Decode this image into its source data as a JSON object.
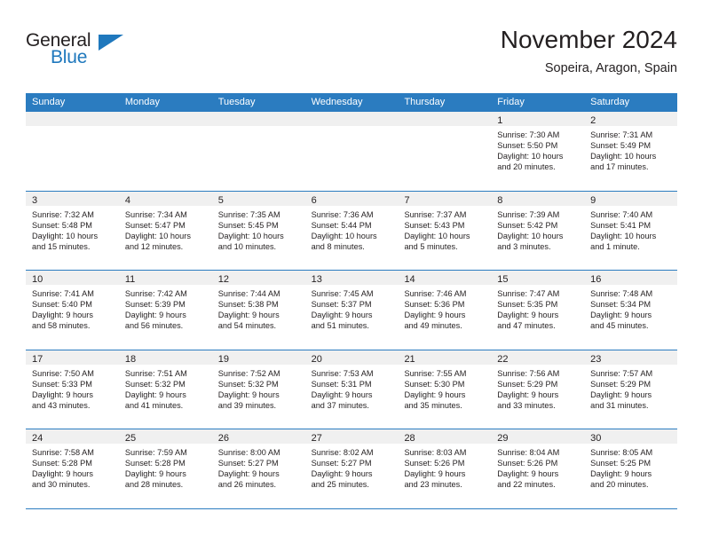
{
  "brand": {
    "name_part1": "General",
    "name_part2": "Blue",
    "accent_color": "#1f78bd"
  },
  "header": {
    "month_title": "November 2024",
    "location": "Sopeira, Aragon, Spain"
  },
  "calendar": {
    "header_color": "#2b7cc0",
    "weekdays": [
      "Sunday",
      "Monday",
      "Tuesday",
      "Wednesday",
      "Thursday",
      "Friday",
      "Saturday"
    ],
    "weeks": [
      [
        {
          "day": "",
          "lines": []
        },
        {
          "day": "",
          "lines": []
        },
        {
          "day": "",
          "lines": []
        },
        {
          "day": "",
          "lines": []
        },
        {
          "day": "",
          "lines": []
        },
        {
          "day": "1",
          "lines": [
            "Sunrise: 7:30 AM",
            "Sunset: 5:50 PM",
            "Daylight: 10 hours",
            "and 20 minutes."
          ]
        },
        {
          "day": "2",
          "lines": [
            "Sunrise: 7:31 AM",
            "Sunset: 5:49 PM",
            "Daylight: 10 hours",
            "and 17 minutes."
          ]
        }
      ],
      [
        {
          "day": "3",
          "lines": [
            "Sunrise: 7:32 AM",
            "Sunset: 5:48 PM",
            "Daylight: 10 hours",
            "and 15 minutes."
          ]
        },
        {
          "day": "4",
          "lines": [
            "Sunrise: 7:34 AM",
            "Sunset: 5:47 PM",
            "Daylight: 10 hours",
            "and 12 minutes."
          ]
        },
        {
          "day": "5",
          "lines": [
            "Sunrise: 7:35 AM",
            "Sunset: 5:45 PM",
            "Daylight: 10 hours",
            "and 10 minutes."
          ]
        },
        {
          "day": "6",
          "lines": [
            "Sunrise: 7:36 AM",
            "Sunset: 5:44 PM",
            "Daylight: 10 hours",
            "and 8 minutes."
          ]
        },
        {
          "day": "7",
          "lines": [
            "Sunrise: 7:37 AM",
            "Sunset: 5:43 PM",
            "Daylight: 10 hours",
            "and 5 minutes."
          ]
        },
        {
          "day": "8",
          "lines": [
            "Sunrise: 7:39 AM",
            "Sunset: 5:42 PM",
            "Daylight: 10 hours",
            "and 3 minutes."
          ]
        },
        {
          "day": "9",
          "lines": [
            "Sunrise: 7:40 AM",
            "Sunset: 5:41 PM",
            "Daylight: 10 hours",
            "and 1 minute."
          ]
        }
      ],
      [
        {
          "day": "10",
          "lines": [
            "Sunrise: 7:41 AM",
            "Sunset: 5:40 PM",
            "Daylight: 9 hours",
            "and 58 minutes."
          ]
        },
        {
          "day": "11",
          "lines": [
            "Sunrise: 7:42 AM",
            "Sunset: 5:39 PM",
            "Daylight: 9 hours",
            "and 56 minutes."
          ]
        },
        {
          "day": "12",
          "lines": [
            "Sunrise: 7:44 AM",
            "Sunset: 5:38 PM",
            "Daylight: 9 hours",
            "and 54 minutes."
          ]
        },
        {
          "day": "13",
          "lines": [
            "Sunrise: 7:45 AM",
            "Sunset: 5:37 PM",
            "Daylight: 9 hours",
            "and 51 minutes."
          ]
        },
        {
          "day": "14",
          "lines": [
            "Sunrise: 7:46 AM",
            "Sunset: 5:36 PM",
            "Daylight: 9 hours",
            "and 49 minutes."
          ]
        },
        {
          "day": "15",
          "lines": [
            "Sunrise: 7:47 AM",
            "Sunset: 5:35 PM",
            "Daylight: 9 hours",
            "and 47 minutes."
          ]
        },
        {
          "day": "16",
          "lines": [
            "Sunrise: 7:48 AM",
            "Sunset: 5:34 PM",
            "Daylight: 9 hours",
            "and 45 minutes."
          ]
        }
      ],
      [
        {
          "day": "17",
          "lines": [
            "Sunrise: 7:50 AM",
            "Sunset: 5:33 PM",
            "Daylight: 9 hours",
            "and 43 minutes."
          ]
        },
        {
          "day": "18",
          "lines": [
            "Sunrise: 7:51 AM",
            "Sunset: 5:32 PM",
            "Daylight: 9 hours",
            "and 41 minutes."
          ]
        },
        {
          "day": "19",
          "lines": [
            "Sunrise: 7:52 AM",
            "Sunset: 5:32 PM",
            "Daylight: 9 hours",
            "and 39 minutes."
          ]
        },
        {
          "day": "20",
          "lines": [
            "Sunrise: 7:53 AM",
            "Sunset: 5:31 PM",
            "Daylight: 9 hours",
            "and 37 minutes."
          ]
        },
        {
          "day": "21",
          "lines": [
            "Sunrise: 7:55 AM",
            "Sunset: 5:30 PM",
            "Daylight: 9 hours",
            "and 35 minutes."
          ]
        },
        {
          "day": "22",
          "lines": [
            "Sunrise: 7:56 AM",
            "Sunset: 5:29 PM",
            "Daylight: 9 hours",
            "and 33 minutes."
          ]
        },
        {
          "day": "23",
          "lines": [
            "Sunrise: 7:57 AM",
            "Sunset: 5:29 PM",
            "Daylight: 9 hours",
            "and 31 minutes."
          ]
        }
      ],
      [
        {
          "day": "24",
          "lines": [
            "Sunrise: 7:58 AM",
            "Sunset: 5:28 PM",
            "Daylight: 9 hours",
            "and 30 minutes."
          ]
        },
        {
          "day": "25",
          "lines": [
            "Sunrise: 7:59 AM",
            "Sunset: 5:28 PM",
            "Daylight: 9 hours",
            "and 28 minutes."
          ]
        },
        {
          "day": "26",
          "lines": [
            "Sunrise: 8:00 AM",
            "Sunset: 5:27 PM",
            "Daylight: 9 hours",
            "and 26 minutes."
          ]
        },
        {
          "day": "27",
          "lines": [
            "Sunrise: 8:02 AM",
            "Sunset: 5:27 PM",
            "Daylight: 9 hours",
            "and 25 minutes."
          ]
        },
        {
          "day": "28",
          "lines": [
            "Sunrise: 8:03 AM",
            "Sunset: 5:26 PM",
            "Daylight: 9 hours",
            "and 23 minutes."
          ]
        },
        {
          "day": "29",
          "lines": [
            "Sunrise: 8:04 AM",
            "Sunset: 5:26 PM",
            "Daylight: 9 hours",
            "and 22 minutes."
          ]
        },
        {
          "day": "30",
          "lines": [
            "Sunrise: 8:05 AM",
            "Sunset: 5:25 PM",
            "Daylight: 9 hours",
            "and 20 minutes."
          ]
        }
      ]
    ]
  }
}
